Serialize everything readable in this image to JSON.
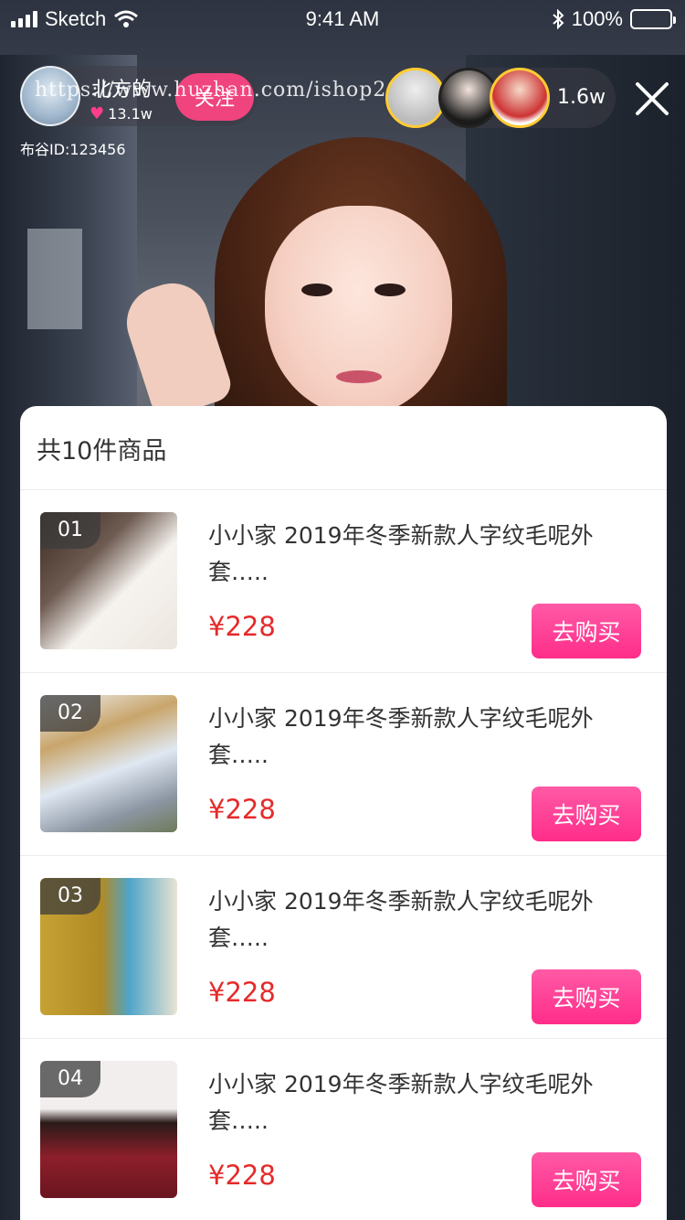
{
  "status_bar": {
    "carrier": "Sketch",
    "time": "9:41 AM",
    "battery": "100%"
  },
  "host": {
    "name": "北方的",
    "likes": "13.1w",
    "follow_label": "关注",
    "id_text": "布谷ID:123456"
  },
  "watermark": "https://www.huzhan.com/ishop20445",
  "viewers": {
    "count": "1.6w"
  },
  "sheet": {
    "title": "共10件商品",
    "items": [
      {
        "index": "01",
        "name": "小小家  2019年冬季新款人字纹毛呢外套…..",
        "price": "¥228",
        "buy_label": "去购买",
        "thumb_colors": [
          "#f6f3ef",
          "#3a2a22",
          "#fbe7e4"
        ]
      },
      {
        "index": "02",
        "name": "小小家  2019年冬季新款人字纹毛呢外套…..",
        "price": "¥228",
        "buy_label": "去购买",
        "thumb_colors": [
          "#dfe8f2",
          "#c9a56b",
          "#8c96a3"
        ]
      },
      {
        "index": "03",
        "name": "小小家  2019年冬季新款人字纹毛呢外套…..",
        "price": "¥228",
        "buy_label": "去购买",
        "thumb_colors": [
          "#4fa5c9",
          "#c6a233",
          "#e9e3d2"
        ]
      },
      {
        "index": "04",
        "name": "小小家  2019年冬季新款人字纹毛呢外套…..",
        "price": "¥228",
        "buy_label": "去购买",
        "thumb_colors": [
          "#f2eeee",
          "#8c1f2a",
          "#2a1a18"
        ]
      }
    ]
  },
  "colors": {
    "accent": "#ff2d8a",
    "price": "#e52a2a",
    "follow": "#f0447e"
  }
}
